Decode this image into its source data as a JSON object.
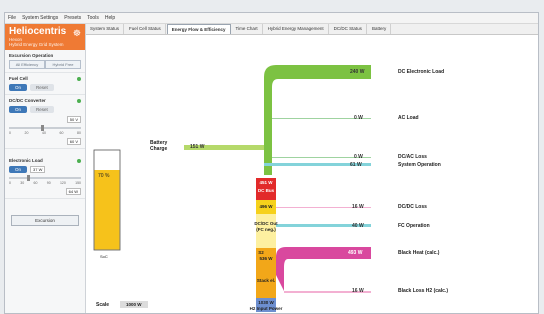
{
  "menu": [
    "File",
    "System Settings",
    "Presets",
    "Tools",
    "Help"
  ],
  "logo": {
    "name": "Heliocentris",
    "tag1": "Hexon",
    "tag2": "Hybrid Energy Grid System",
    "mark": "☸"
  },
  "sidebar": {
    "title": "Excursion Operation",
    "mode_a": "All Efficiency",
    "mode_b": "Hybrid Free",
    "fuel_cell": {
      "label": "Fuel Cell",
      "on": "On",
      "reset": "Reset"
    },
    "dcdc": {
      "label": "DC/DC Converter",
      "on": "On",
      "reset": "Reset",
      "v1": "50 V",
      "v2": "60 V",
      "ticks": [
        "0",
        "20",
        "40",
        "60",
        "80"
      ]
    },
    "load": {
      "label": "Electronic Load",
      "on": "On",
      "value": "37 W",
      "v2": "64 W",
      "ticks": [
        "0",
        "30",
        "60",
        "90",
        "120",
        "150"
      ]
    },
    "excursion_btn": "Excursion"
  },
  "tabs": [
    "System Status",
    "Fuel Cell Status",
    "Energy Flow & Efficiency",
    "Time Chart",
    "Hybrid Energy Management",
    "DC/DC Status",
    "Battery"
  ],
  "active_tab": 2,
  "diagram": {
    "battery_pct": "70 %",
    "battery_label": "SoC",
    "battery_charge_label": "Battery\nCharge",
    "battery_charge_val": "151 W",
    "outputs": [
      {
        "val": "240 W",
        "label": "DC Electronic Load"
      },
      {
        "val": "0 W",
        "label": "AC Load"
      },
      {
        "val": "0 W",
        "label": "DC/AC Loss"
      },
      {
        "val": "61 W",
        "label": "System Operation"
      },
      {
        "val": "16 W",
        "label": "DC/DC Loss"
      },
      {
        "val": "40 W",
        "label": "FC Operation"
      },
      {
        "val": "493 W",
        "label": "Black Heat (calc.)"
      },
      {
        "val": "16 W",
        "label": "Black Loss H2 (calc.)"
      }
    ],
    "stack": {
      "dcbus_val": "451 W",
      "dcbus_label": "DC Bus",
      "dcdc_in_val": "496 W",
      "dcdc_out_label": "DC/DC Out\n(FC neg.)",
      "s2": "S2",
      "s2_val": "536 W",
      "stack_el": "Stack el.",
      "h2_val": "1030 W",
      "h2_label": "H2 Input Power"
    },
    "scale_label": "Scale",
    "scale_val": "1000 W"
  },
  "colors": {
    "green": "#7cc242",
    "lightgreen": "#b5d96a",
    "red": "#e22a2a",
    "yellow": "#f6d11b",
    "orange": "#f2a719",
    "magenta": "#d9489e",
    "blue": "#6d8fd0",
    "cyan": "#83d3da",
    "pink": "#f3b0d2"
  }
}
